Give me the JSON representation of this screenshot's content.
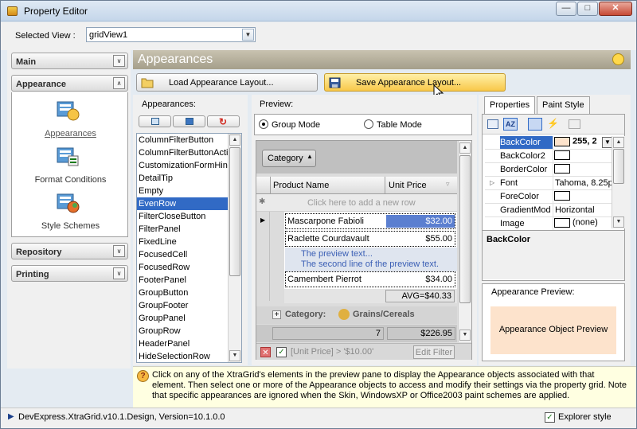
{
  "window": {
    "title": "Property Editor"
  },
  "selected_view": {
    "label": "Selected View :",
    "value": "gridView1"
  },
  "nav": {
    "groups": [
      {
        "label": "Main"
      },
      {
        "label": "Appearance"
      },
      {
        "label": "Repository"
      },
      {
        "label": "Printing"
      }
    ],
    "items": [
      {
        "label": "Appearances",
        "icon": "appearances-icon"
      },
      {
        "label": "Format Conditions",
        "icon": "format-conditions-icon"
      },
      {
        "label": "Style Schemes",
        "icon": "style-schemes-icon"
      }
    ]
  },
  "header": {
    "title": "Appearances"
  },
  "toolbar": {
    "load_label": "Load Appearance Layout...",
    "save_label": "Save Appearance Layout..."
  },
  "appearances": {
    "label": "Appearances:",
    "items": [
      "ColumnFilterButton",
      "ColumnFilterButtonActive",
      "CustomizationFormHint",
      "DetailTip",
      "Empty",
      "EvenRow",
      "FilterCloseButton",
      "FilterPanel",
      "FixedLine",
      "FocusedCell",
      "FocusedRow",
      "FooterPanel",
      "GroupButton",
      "GroupFooter",
      "GroupPanel",
      "GroupRow",
      "HeaderPanel",
      "HideSelectionRow"
    ],
    "selected": "EvenRow"
  },
  "preview": {
    "label": "Preview:",
    "modes": [
      "Group Mode",
      "Table Mode"
    ],
    "selected_mode": "Group Mode",
    "group_button": "Category",
    "columns": [
      "Product Name",
      "Unit Price"
    ],
    "new_row_text": "Click here to add a new row",
    "rows": [
      {
        "name": "Mascarpone Fabioli",
        "price": "$32.00"
      },
      {
        "name": "Raclette Courdavault",
        "price": "$55.00"
      },
      {
        "name": "Camembert Pierrot",
        "price": "$34.00"
      }
    ],
    "preview_lines": [
      "The preview text...",
      "The second line of the preview text."
    ],
    "group_footer": "AVG=$40.33",
    "group_row_prefix": "Category:",
    "group_row_value": "Grains/Cereals",
    "footer_count": "7",
    "footer_sum": "$226.95",
    "filter_text": "[Unit Price] > '$10.00'",
    "edit_filter": "Edit Filter"
  },
  "property_grid": {
    "tabs": [
      "Properties",
      "Paint Style"
    ],
    "rows": [
      {
        "name": "BackColor",
        "value": "255, 2"
      },
      {
        "name": "BackColor2",
        "value": ""
      },
      {
        "name": "BorderColor",
        "value": ""
      },
      {
        "name": "Font",
        "value": "Tahoma, 8.25pt"
      },
      {
        "name": "ForeColor",
        "value": ""
      },
      {
        "name": "GradientMode",
        "value": "Horizontal"
      },
      {
        "name": "Image",
        "value": "(none)"
      }
    ],
    "description_title": "BackColor"
  },
  "appearance_preview": {
    "label": "Appearance Preview:",
    "sample": "Appearance Object Preview"
  },
  "hint": {
    "text": "Click on any of the XtraGrid's elements in the preview pane to display the Appearance objects associated with that element. Then select one or more of the Appearance objects to access and modify their settings via the property grid. Note that specific appearances are ignored when the Skin, WindowsXP or Office2003 paint schemes are applied."
  },
  "status": {
    "version": "DevExpress.XtraGrid.v10.1.Design, Version=10.1.0.0",
    "explorer_style": "Explorer style"
  },
  "colors": {
    "header": "#a8a290",
    "selection": "#316ac5",
    "save_button": "#f8c84a",
    "preview_bg": "#fde3cc"
  }
}
